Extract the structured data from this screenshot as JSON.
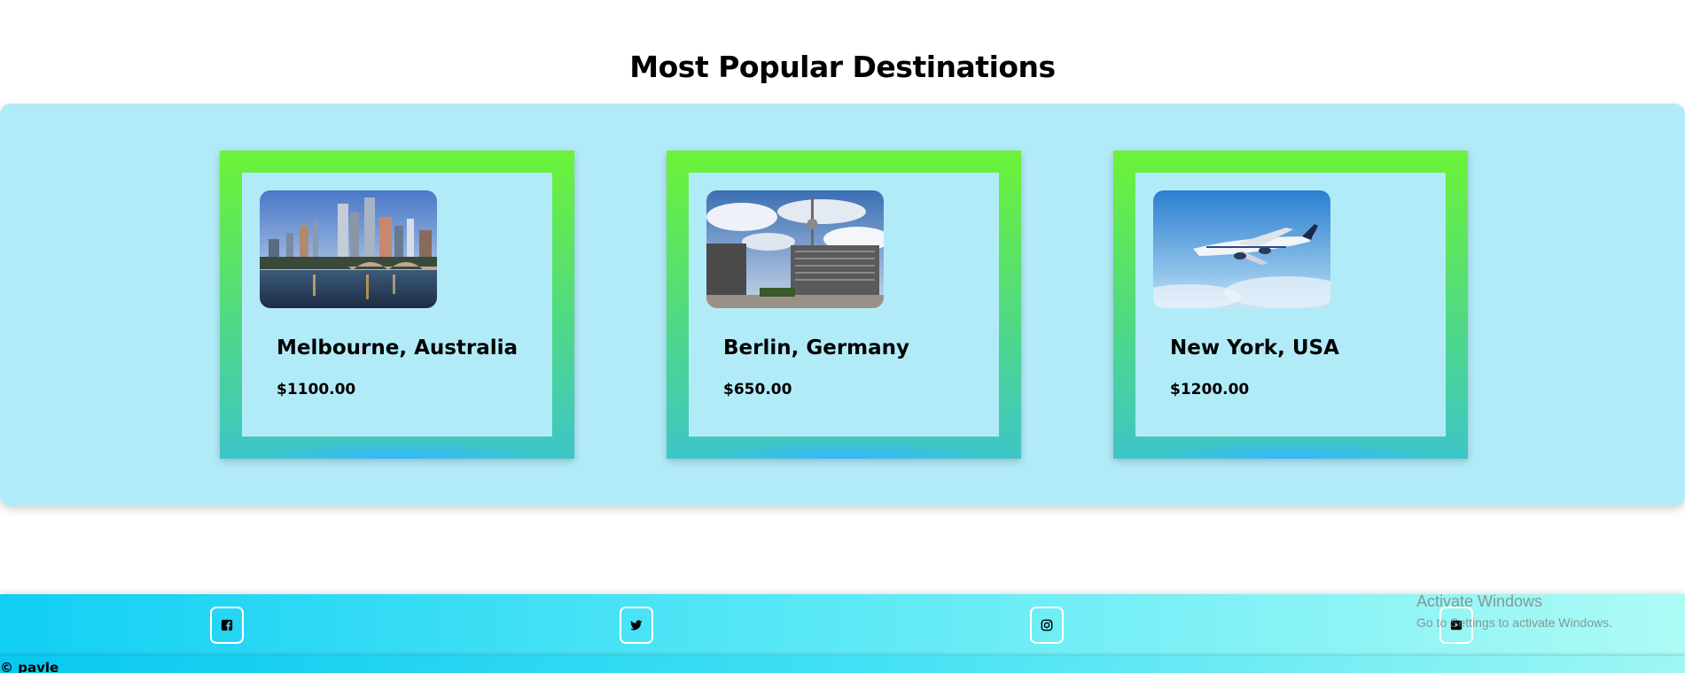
{
  "section": {
    "title": "Most Popular Destinations"
  },
  "destinations": [
    {
      "name": "Melbourne, Australia",
      "price": "$1100.00",
      "image": "melbourne-city-skyline-photo"
    },
    {
      "name": "Berlin, Germany",
      "price": "$650.00",
      "image": "berlin-tv-tower-photo"
    },
    {
      "name": "New York, USA",
      "price": "$1200.00",
      "image": "airplane-in-sky-photo"
    }
  ],
  "footer": {
    "social": [
      "facebook-icon",
      "twitter-icon",
      "instagram-icon",
      "youtube-icon"
    ],
    "copyright": "© pavle"
  },
  "watermark": {
    "title": "Activate Windows",
    "subtitle": "Go to Settings to activate Windows."
  },
  "colors": {
    "panel": "#b2ebf8",
    "card_gradient_top": "#6cf337",
    "card_gradient_bottom": "#3ec5c8",
    "footer_start": "#12cff4",
    "footer_end": "#adfbf5"
  }
}
